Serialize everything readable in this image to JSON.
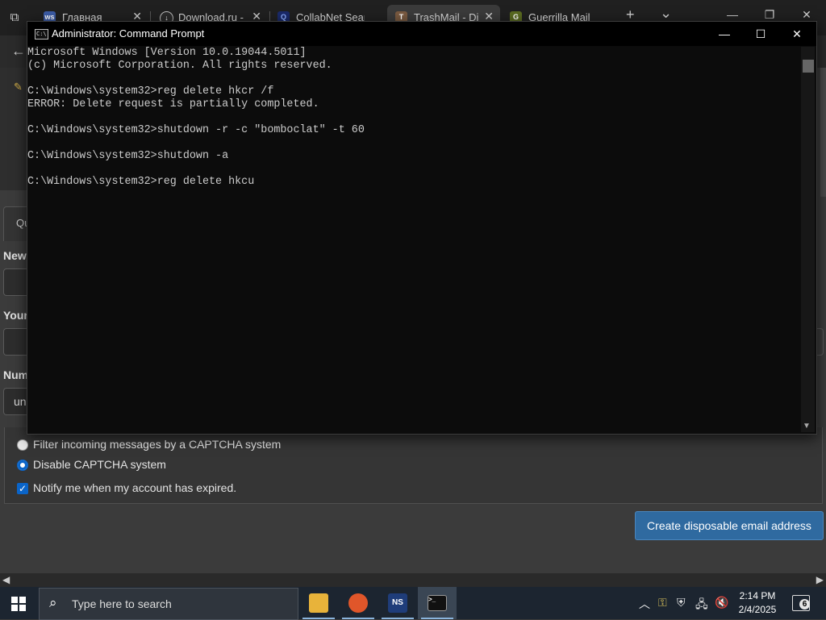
{
  "browser": {
    "tabs": [
      {
        "title": "Главная",
        "favicon": "ws-favicon",
        "favicon_text": "ws",
        "favicon_color": "#3b5ba5"
      },
      {
        "title": "Download.ru - о",
        "favicon": "download-favicon",
        "favicon_text": "↓",
        "favicon_color": "#2a2a2a"
      },
      {
        "title": "CollabNet Searc",
        "favicon": "search-favicon",
        "favicon_text": "Q",
        "favicon_color": "#1a2a6a"
      },
      {
        "title": "TrashMail - Disp",
        "favicon": "trashmail-favicon",
        "favicon_text": "T",
        "favicon_color": "#7a5a40"
      },
      {
        "title": "Guerrilla Mail",
        "favicon": "guerrilla-favicon",
        "favicon_text": "G",
        "favicon_color": "#5a6a20"
      }
    ],
    "active_tab": 3,
    "new_tab_symbol": "+",
    "tab_list_symbol": "⌄"
  },
  "page": {
    "tab_partial": "Qu",
    "labels": [
      "New",
      "Your",
      "Num"
    ],
    "field_partial": "un",
    "options": [
      {
        "label": "Filter incoming messages by a CAPTCHA system",
        "type": "radio",
        "checked": false
      },
      {
        "label": "Disable CAPTCHA system",
        "type": "radio",
        "checked": true
      },
      {
        "label": "Notify me when my account has expired.",
        "type": "checkbox",
        "checked": true
      }
    ],
    "create_button": "Create disposable email address"
  },
  "cmd": {
    "title": "Administrator: Command Prompt",
    "lines": [
      "Microsoft Windows [Version 10.0.19044.5011]",
      "(c) Microsoft Corporation. All rights reserved.",
      "",
      "C:\\Windows\\system32>reg delete hkcr /f",
      "ERROR: Delete request is partially completed.",
      "",
      "C:\\Windows\\system32>shutdown -r -c \"bomboclat\" -t 60",
      "",
      "C:\\Windows\\system32>shutdown -a",
      "",
      "C:\\Windows\\system32>reg delete hkcu"
    ]
  },
  "taskbar": {
    "search_placeholder": "Type here to search",
    "apps": [
      {
        "name": "file-explorer",
        "color": "#e8b33a"
      },
      {
        "name": "firefox",
        "color": "#e0562a"
      },
      {
        "name": "ns-app",
        "label": "NS",
        "color": "#1f3d7a"
      },
      {
        "name": "command-prompt",
        "color": "#111111"
      }
    ],
    "time": "2:14 PM",
    "date": "2/4/2025",
    "notification_count": "6"
  }
}
